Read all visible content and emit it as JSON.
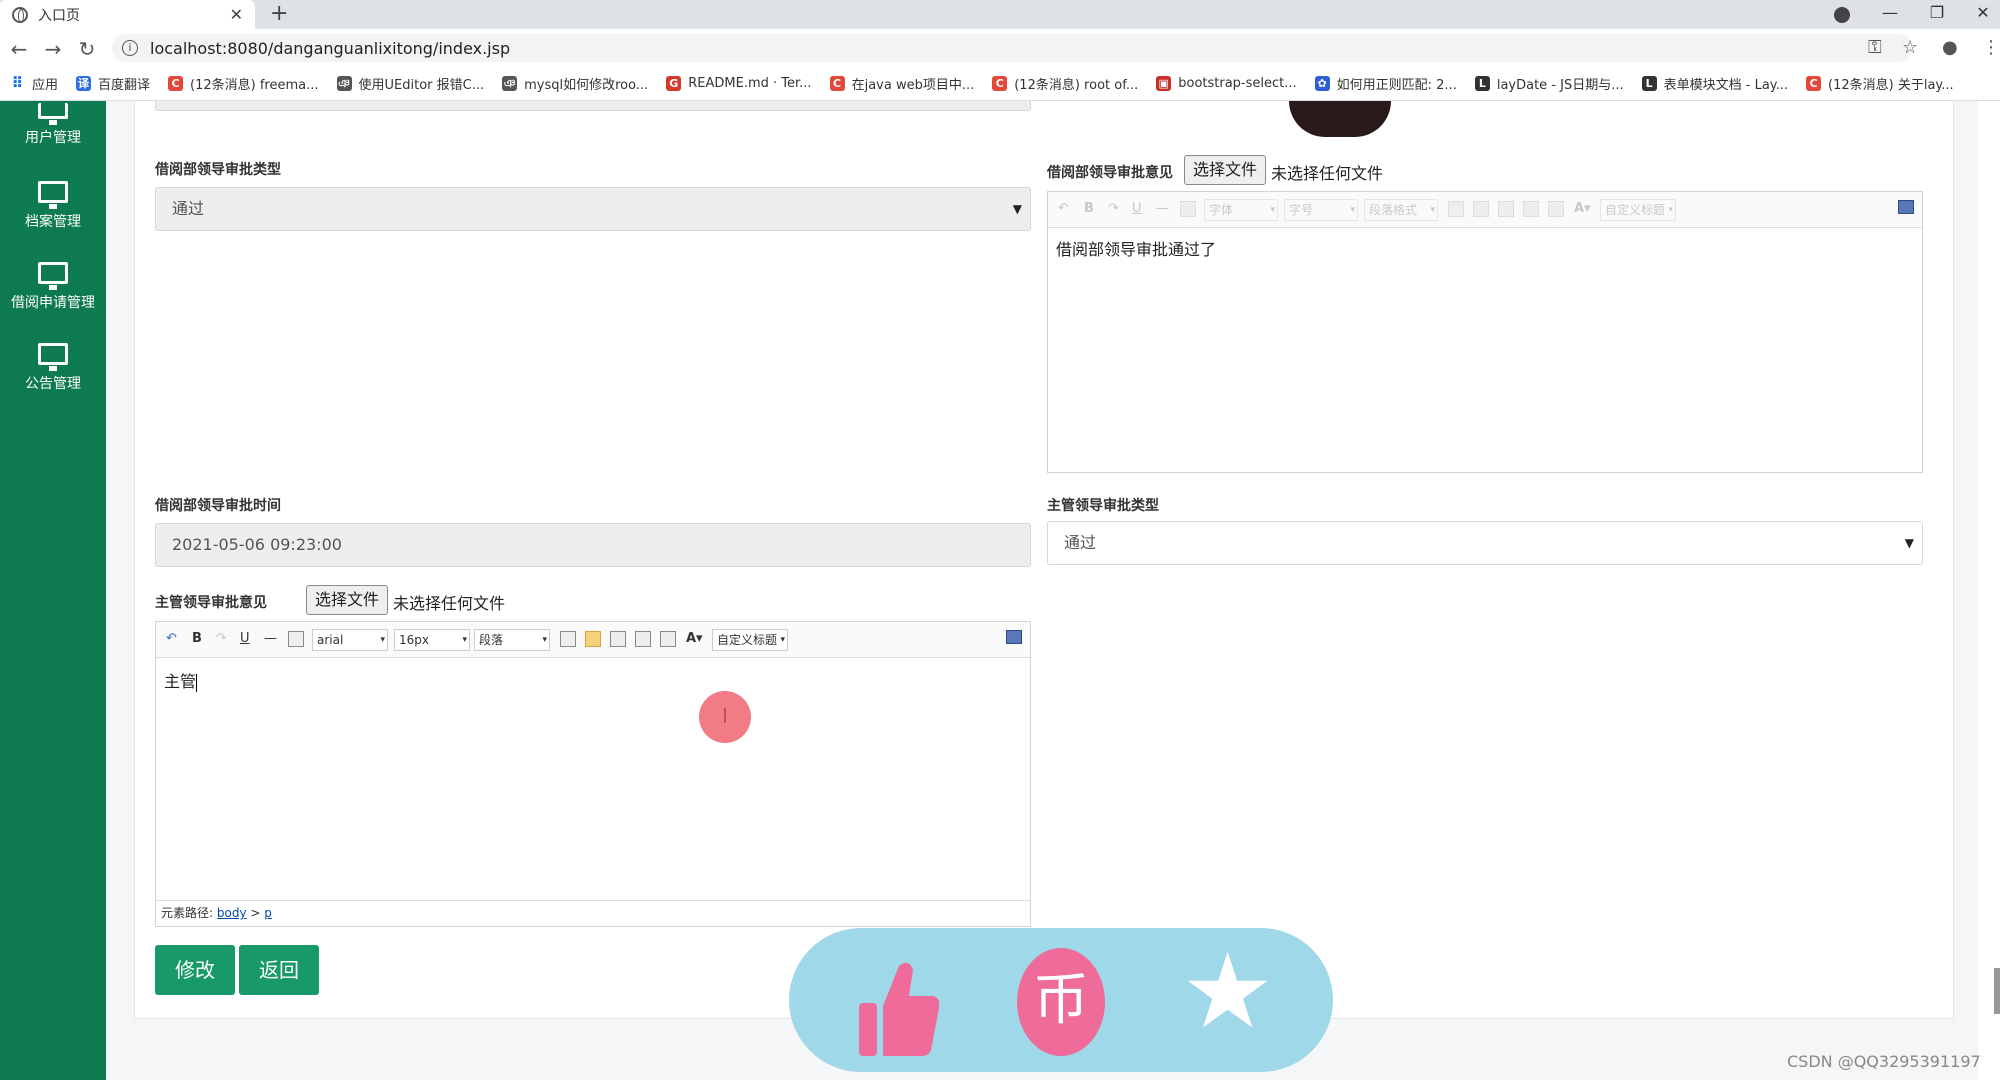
{
  "browser": {
    "tab_title": "入口页",
    "url": "localhost:8080/danganguanlixitong/index.jsp",
    "bookmarks": [
      {
        "label": "应用",
        "color": "#1a73e8",
        "glyph": "⠿"
      },
      {
        "label": "百度翻译",
        "color": "#2f6fe4",
        "glyph": "译"
      },
      {
        "label": "(12条消息) freema...",
        "color": "#e3483b",
        "glyph": "C"
      },
      {
        "label": "使用UEditor 报错C...",
        "color": "#555555",
        "glyph": "ঞ"
      },
      {
        "label": "mysql如何修改roo...",
        "color": "#555555",
        "glyph": "ঞ"
      },
      {
        "label": "README.md · Ter...",
        "color": "#d33a2c",
        "glyph": "G"
      },
      {
        "label": "在java web项目中...",
        "color": "#e3483b",
        "glyph": "C"
      },
      {
        "label": "(12条消息) root of...",
        "color": "#e3483b",
        "glyph": "C"
      },
      {
        "label": "bootstrap-select...",
        "color": "#c9302c",
        "glyph": "▣"
      },
      {
        "label": "如何用正则匹配: 2...",
        "color": "#2f5fd8",
        "glyph": "✿"
      },
      {
        "label": "layDate - JS日期与...",
        "color": "#333333",
        "glyph": "L"
      },
      {
        "label": "表单模块文档 - Lay...",
        "color": "#333333",
        "glyph": "L"
      },
      {
        "label": "(12条消息) 关于lay...",
        "color": "#e3483b",
        "glyph": "C"
      }
    ]
  },
  "sidebar": {
    "items": [
      {
        "label": "用户管理"
      },
      {
        "label": "档案管理"
      },
      {
        "label": "借阅申请管理"
      },
      {
        "label": "公告管理"
      }
    ]
  },
  "form": {
    "dept_type_label": "借阅部领导审批类型",
    "dept_type_value": "通过",
    "dept_opinion_label": "借阅部领导审批意见",
    "file_btn": "选择文件",
    "file_none": "未选择任何文件",
    "dept_opinion_text": "借阅部领导审批通过了",
    "dept_time_label": "借阅部领导审批时间",
    "dept_time_value": "2021-05-06 09:23:00",
    "mgr_type_label": "主管领导审批类型",
    "mgr_type_value": "通过",
    "mgr_opinion_label": "主管领导审批意见",
    "mgr_opinion_text": "主管",
    "toolbar": {
      "font_dim": "字体",
      "size_dim": "字号",
      "para_dim": "段落格式",
      "title_dim": "自定义标题",
      "font": "arial",
      "size": "16px",
      "para": "段落",
      "title": "自定义标题"
    },
    "path_label": "元素路径:",
    "path_body": "body",
    "path_sep": ">",
    "path_p": "p",
    "edit_button": "修改",
    "back_button": "返回"
  },
  "watermark": "CSDN @QQ3295391197",
  "colors": {
    "sidebar": "#0d7a4f",
    "button": "#179a68",
    "overlay": "#9fd8e8",
    "overlay_icons": "#ee6b9a"
  }
}
